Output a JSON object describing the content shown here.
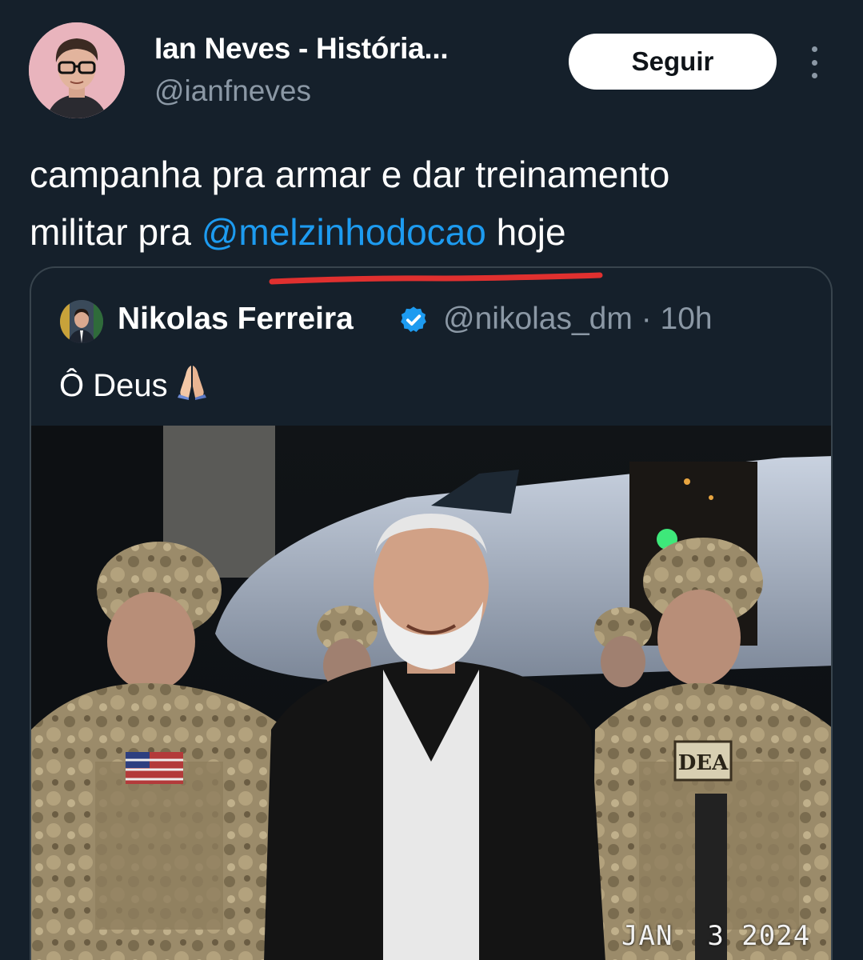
{
  "author": {
    "name": "Ian Neves - História...",
    "handle": "@ianfneves",
    "follow_label": "Seguir"
  },
  "tweet": {
    "line1": "campanha pra armar e dar treinamento",
    "line2_prefix": "militar pra ",
    "mention": "@melzinhodocao",
    "line2_suffix": " hoje"
  },
  "quoted": {
    "name": "Nikolas Ferreira",
    "handle_time": "@nikolas_dm · 10h",
    "text": "Ô Deus",
    "photo_stamp": "JAN  3 2024",
    "vest_badge": "DEA"
  },
  "colors": {
    "background": "#15202b",
    "mention": "#1d9bf0",
    "secondary_text": "#8b98a5",
    "underline": "#e0302f",
    "verified": "#1d9bf0"
  },
  "icons": [
    "more-vertical-icon",
    "verified-badge-icon",
    "folded-hands-icon"
  ]
}
